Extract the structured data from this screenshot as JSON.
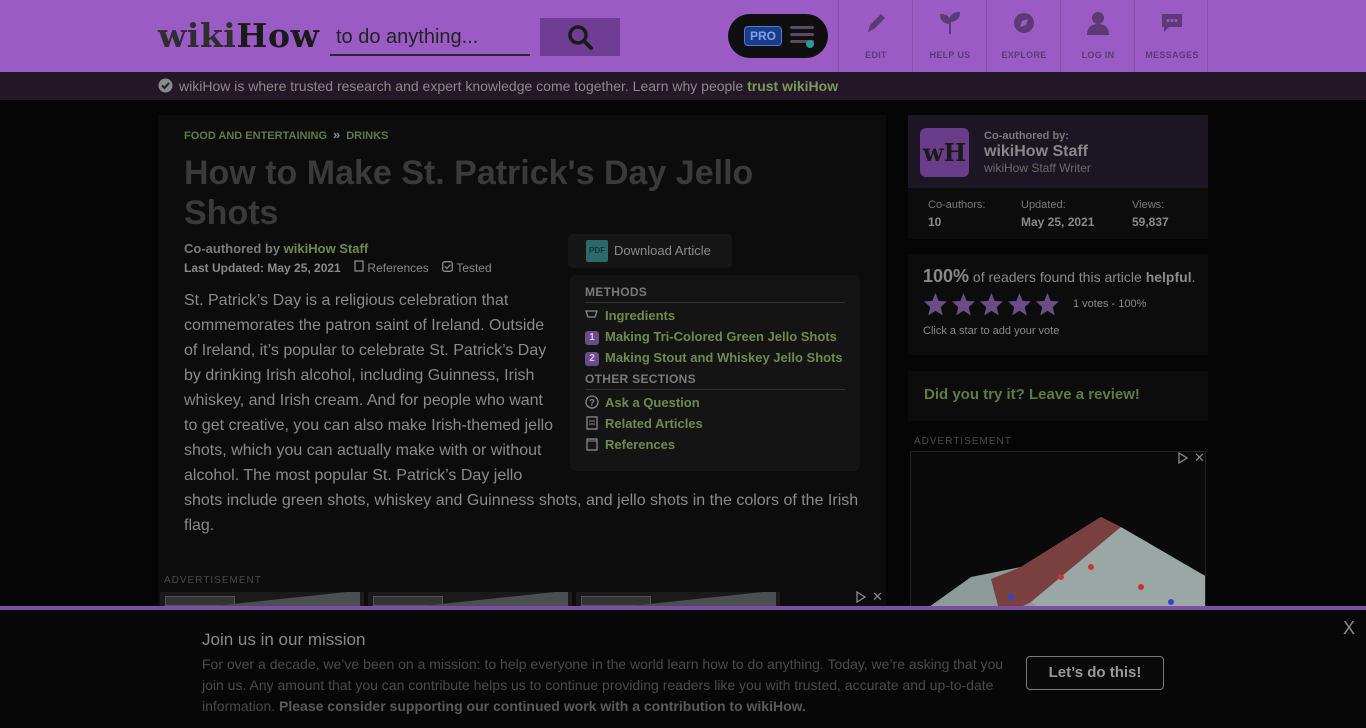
{
  "header": {
    "logo_wiki": "wiki",
    "logo_how": "How",
    "search_placeholder": "to do anything...",
    "pro_label": "PRO",
    "nav": [
      {
        "label": "EDIT",
        "icon": "pencil-icon"
      },
      {
        "label": "HELP US",
        "icon": "sprout-icon"
      },
      {
        "label": "EXPLORE",
        "icon": "compass-icon"
      },
      {
        "label": "LOG IN",
        "icon": "user-icon"
      },
      {
        "label": "MESSAGES",
        "icon": "chat-icon"
      }
    ],
    "accent": "#9a5cc4"
  },
  "trust": {
    "text": "wikiHow is where trusted research and expert knowledge come together. Learn why people ",
    "link": "trust wikiHow"
  },
  "article": {
    "breadcrumb": [
      "FOOD AND ENTERTAINING",
      "DRINKS"
    ],
    "breadcrumb_sep": "»",
    "title": "How to Make St. Patrick's Day Jello Shots",
    "coauthored_prefix": "Co-authored by ",
    "coauthor": "wikiHow Staff",
    "last_updated": "Last Updated: May 25, 2021",
    "references_label": "References",
    "tested_label": "Tested",
    "intro": "St. Patrick’s Day is a religious celebration that commemorates the patron saint of Ireland. Outside of Ireland, it’s popular to celebrate St. Patrick’s Day by drinking Irish alcohol, including Guinness, Irish whiskey, and Irish cream. And for people who want to get creative, you can also make Irish-themed jello shots, which you can actually make with or without alcohol. The most popular St. Patrick’s Day jello shots include green shots, whiskey and Guinness shots, and jello shots in the colors of the Irish flag.",
    "download_label": "Download Article",
    "pdf_label": "PDF",
    "toc": {
      "methods_header": "METHODS",
      "ingredients": "Ingredients",
      "methods": [
        {
          "num": "1",
          "label": "Making Tri-Colored Green Jello Shots"
        },
        {
          "num": "2",
          "label": "Making Stout and Whiskey Jello Shots"
        }
      ],
      "other_header": "OTHER SECTIONS",
      "other": [
        {
          "label": "Ask a Question",
          "icon": "question-icon"
        },
        {
          "label": "Related Articles",
          "icon": "document-icon"
        },
        {
          "label": "References",
          "icon": "clipboard-icon"
        }
      ]
    },
    "ad_label": "ADVERTISEMENT"
  },
  "sidebar": {
    "coauthored_by": "Co-authored by:",
    "author_name": "wikiHow Staff",
    "author_role": "wikiHow Staff Writer",
    "wh_logo": "wH",
    "stats": [
      {
        "key": "Co-authors:",
        "value": "10"
      },
      {
        "key": "Updated:",
        "value": "May 25, 2021"
      },
      {
        "key": "Views:",
        "value": "59,837"
      }
    ],
    "helpful_pct": "100%",
    "helpful_mid": " of readers found this article ",
    "helpful_word": "helpful",
    "helpful_end": ".",
    "rating_stars": 5,
    "votes": "1 votes - 100%",
    "click_star": "Click a star to add your vote",
    "review_prompt": "Did you try it? Leave a review!",
    "ad_label": "ADVERTISEMENT"
  },
  "banner": {
    "title": "Join us in our mission",
    "text": "For over a decade, we’ve been on a mission: to help everyone in the world learn how to do anything. Today, we’re asking that you join us. Any amount that you can contribute helps us to continue providing readers like you with trusted, accurate and up-to-date information. ",
    "text_bold": "Please consider supporting our continued work with a contribution to wikiHow.",
    "button": "Let’s do this!",
    "close": "X"
  }
}
